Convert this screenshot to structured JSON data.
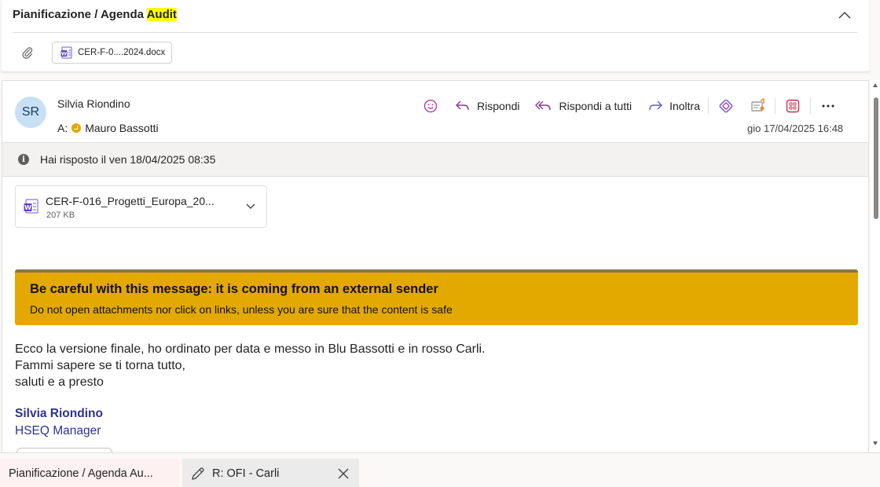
{
  "top_message": {
    "subject_prefix": "Pianificazione / Agenda ",
    "subject_highlight": "Audit",
    "attachment_name": "CER-F-0....2024.docx"
  },
  "email": {
    "avatar_initials": "SR",
    "sender": "Silvia Riondino",
    "to_label": "A:",
    "recipient": "Mauro Bassotti",
    "actions": {
      "reply": "Rispondi",
      "reply_all": "Rispondi a tutti",
      "forward": "Inoltra"
    },
    "date": "gio 17/04/2025 16:48",
    "info_text": "Hai risposto il ven 18/04/2025 08:35",
    "attachment": {
      "name": "CER-F-016_Progetti_Europa_20...",
      "size": "207 KB"
    },
    "banner": {
      "title": "Be careful with this message: it is coming from an external sender",
      "subtitle": "Do not open attachments nor click on links, unless you are sure that the content is safe"
    },
    "body_lines": [
      "Ecco la versione finale, ho ordinato per data e messo in Blu Bassotti e in rosso Carli.",
      "Fammi sapere se ti torna tutto,",
      "saluti e a presto"
    ],
    "signature": {
      "name": "Silvia Riondino",
      "role": "HSEQ Manager"
    }
  },
  "tabs": [
    {
      "label": "Pianificazione / Agenda Au..."
    },
    {
      "label": "R: OFI - Carli"
    }
  ],
  "colors": {
    "banner": "#e3a900",
    "signature": "#2e3192",
    "action_icon": "#8a3a8f",
    "highlight": "#ffff00"
  }
}
